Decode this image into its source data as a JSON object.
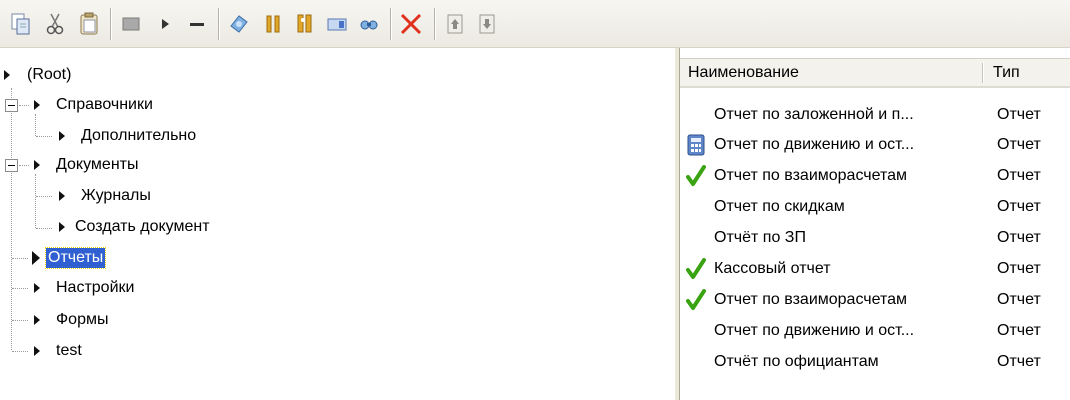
{
  "toolbar": {
    "buttons": [
      {
        "icon": "copy-icon"
      },
      {
        "icon": "cut-icon"
      },
      {
        "icon": "paste-icon"
      },
      {
        "icon": "stop-icon"
      },
      {
        "icon": "play-icon"
      },
      {
        "icon": "minus-icon"
      },
      {
        "icon": "properties-icon"
      },
      {
        "icon": "tools-icon"
      },
      {
        "icon": "find-icon"
      },
      {
        "icon": "module-icon"
      },
      {
        "icon": "binoculars-icon"
      },
      {
        "icon": "delete-icon"
      },
      {
        "icon": "move-up-icon"
      },
      {
        "icon": "move-down-icon"
      }
    ]
  },
  "tree": {
    "items": [
      {
        "label": "(Root)"
      },
      {
        "label": "Справочники"
      },
      {
        "label": "Дополнительно"
      },
      {
        "label": "Документы"
      },
      {
        "label": "Журналы"
      },
      {
        "label": "Создать документ"
      },
      {
        "label": "Отчеты"
      },
      {
        "label": "Настройки"
      },
      {
        "label": "Формы"
      },
      {
        "label": "test"
      }
    ]
  },
  "list": {
    "columns": [
      "Наименование",
      "Тип"
    ],
    "rows": [
      {
        "name": "Отчет по заложенной и п...",
        "type": "Отчет",
        "icon": ""
      },
      {
        "name": "Отчет по движению и ост...",
        "type": "Отчет",
        "icon": "calculator-icon"
      },
      {
        "name": "Отчет по взаиморасчетам",
        "type": "Отчет",
        "icon": "checkmark-icon"
      },
      {
        "name": "Отчет по скидкам",
        "type": "Отчет",
        "icon": ""
      },
      {
        "name": "Отчёт по ЗП",
        "type": "Отчет",
        "icon": ""
      },
      {
        "name": "Кассовый отчет",
        "type": "Отчет",
        "icon": "checkmark-icon"
      },
      {
        "name": "Отчет по взаиморасчетам",
        "type": "Отчет",
        "icon": "checkmark-icon"
      },
      {
        "name": "Отчет по движению и ост...",
        "type": "Отчет",
        "icon": ""
      },
      {
        "name": "Отчёт по официантам",
        "type": "Отчет",
        "icon": ""
      }
    ]
  },
  "colors": {
    "selection": "#2f5fd0",
    "toolbar_bg": "#ece9d8",
    "check_green": "#3aa312",
    "delete_red": "#e0301e"
  }
}
